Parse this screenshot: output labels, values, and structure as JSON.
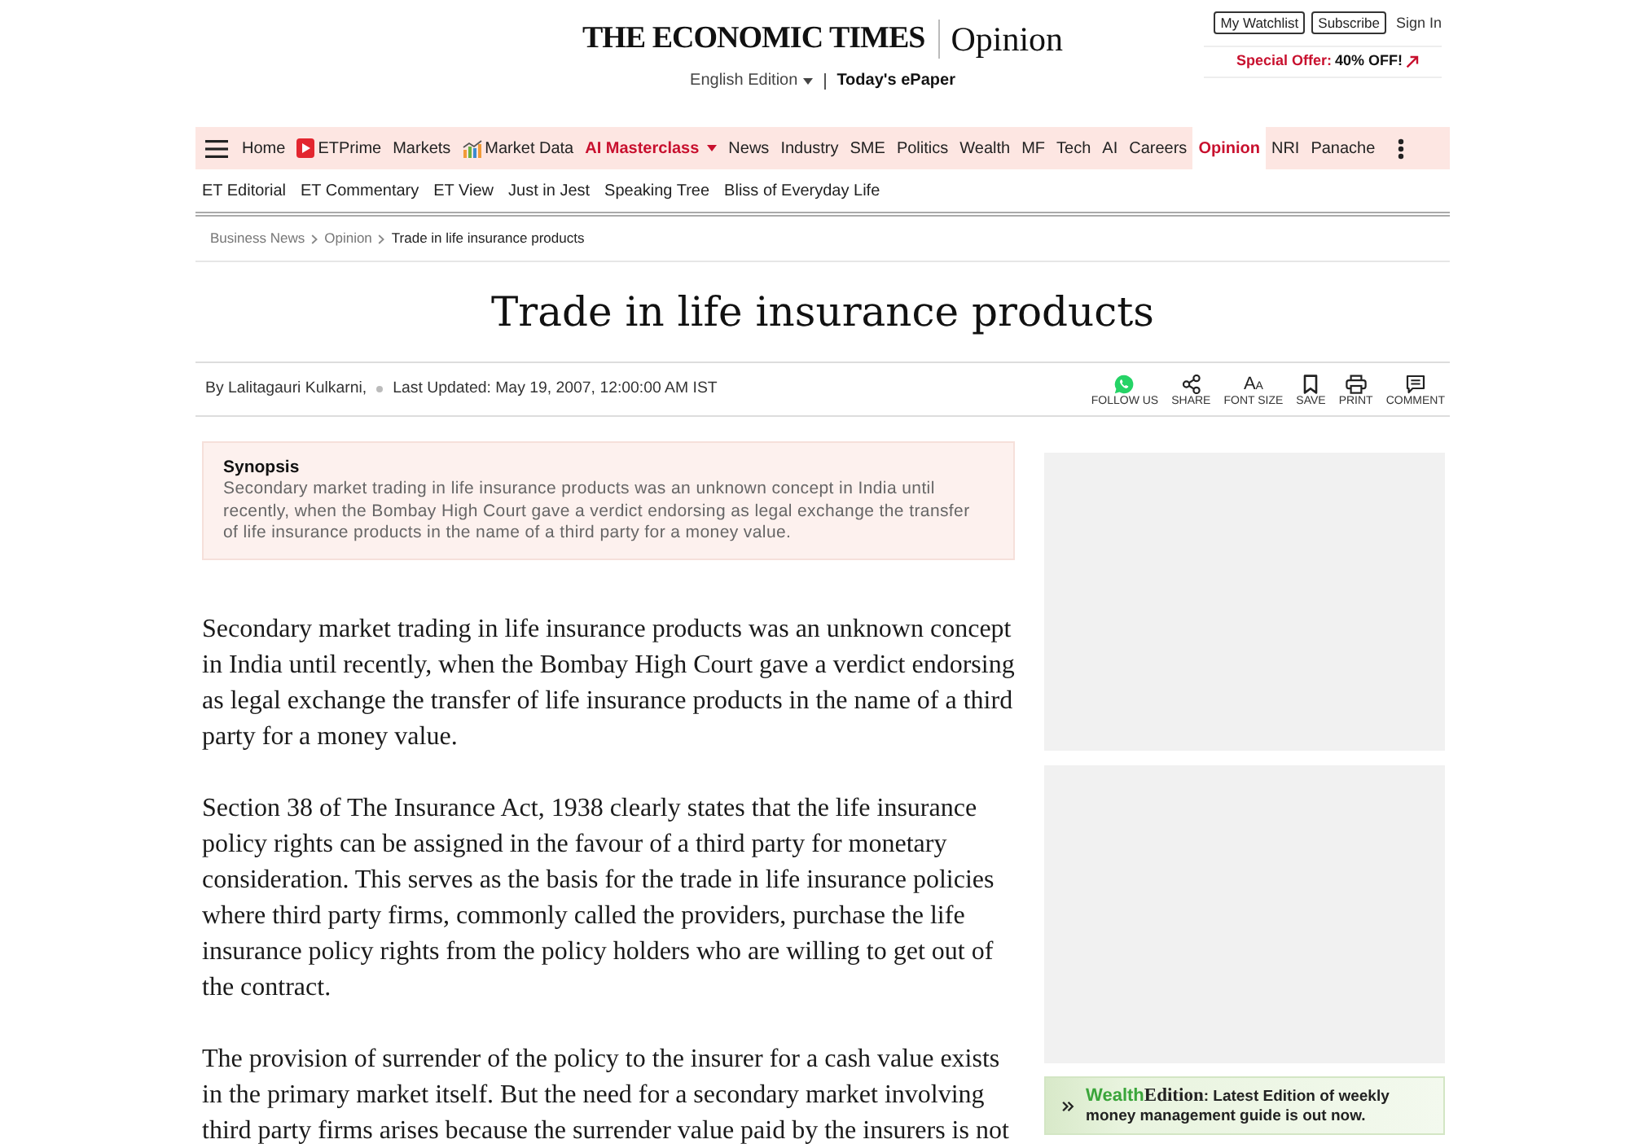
{
  "header": {
    "logo": "THE ECONOMIC TIMES",
    "section": "Opinion",
    "edition": "English Edition",
    "epaper": "Today's ePaper",
    "account_buttons": [
      {
        "label": "My Watchlist",
        "kind": "outline"
      },
      {
        "label": "Subscribe",
        "kind": "outline"
      },
      {
        "label": "Sign In",
        "kind": "link"
      }
    ],
    "offer": {
      "label": "Special Offer:",
      "value": "40% OFF!"
    }
  },
  "nav": [
    {
      "label": "Home",
      "kind": "link",
      "selected": false
    },
    {
      "label": "ETPrime",
      "kind": "prime",
      "selected": false
    },
    {
      "label": "Markets",
      "kind": "link",
      "selected": false
    },
    {
      "label": "Market Data",
      "kind": "chart",
      "selected": false
    },
    {
      "label": "AI Masterclass",
      "kind": "promo",
      "selected": false
    },
    {
      "label": "News",
      "kind": "link",
      "selected": false
    },
    {
      "label": "Industry",
      "kind": "link",
      "selected": false
    },
    {
      "label": "SME",
      "kind": "link",
      "selected": false
    },
    {
      "label": "Politics",
      "kind": "link",
      "selected": false
    },
    {
      "label": "Wealth",
      "kind": "link",
      "selected": false
    },
    {
      "label": "MF",
      "kind": "link",
      "selected": false
    },
    {
      "label": "Tech",
      "kind": "link",
      "selected": false
    },
    {
      "label": "AI",
      "kind": "link",
      "selected": false
    },
    {
      "label": "Careers",
      "kind": "link",
      "selected": false
    },
    {
      "label": "Opinion",
      "kind": "link",
      "selected": true
    },
    {
      "label": "NRI",
      "kind": "link",
      "selected": false
    },
    {
      "label": "Panache",
      "kind": "link",
      "selected": false
    }
  ],
  "subnav": [
    "ET Editorial",
    "ET Commentary",
    "ET View",
    "Just in Jest",
    "Speaking Tree",
    "Bliss of Everyday Life"
  ],
  "breadcrumb": [
    "Business News",
    "Opinion",
    "Trade in life insurance products"
  ],
  "title": "Trade in life insurance products",
  "byline": {
    "author": "By Lalitagauri Kulkarni,",
    "updated": "Last Updated: May 19, 2007, 12:00:00 AM IST"
  },
  "share_tools": [
    {
      "kind": "whatsapp",
      "label": "FOLLOW US"
    },
    {
      "kind": "share",
      "label": "SHARE"
    },
    {
      "kind": "font",
      "label": "FONT SIZE",
      "glyph_large": "A",
      "glyph_small": "A"
    },
    {
      "kind": "save",
      "label": "SAVE"
    },
    {
      "kind": "print",
      "label": "PRINT"
    },
    {
      "kind": "comment",
      "label": "COMMENT"
    }
  ],
  "synopsis": {
    "heading": "Synopsis",
    "text": "Secondary market trading in life insurance products was an unknown concept in India until recently, when the Bombay High Court gave a verdict endorsing as legal exchange the transfer of life insurance products in the name of a third party for a money value."
  },
  "paragraphs": [
    "Secondary market trading in life insurance products was an unknown concept in India until recently, when the Bombay High Court gave a verdict endorsing as legal exchange the transfer of life insurance products in the name of a third party for a money value.",
    "Section 38 of The Insurance Act, 1938 clearly states that the life insurance policy rights can be assigned in the favour of a third party for monetary consideration. This serves as the basis for the trade in life insurance policies where third party firms, commonly called the providers, purchase the life insurance policy rights from the policy holders who are willing to get out of the contract.",
    "The provision of surrender of the policy to the insurer for a cash value exists in the primary market itself. But the need for a secondary market involving third party firms arises because the surrender value paid by the insurers is not"
  ],
  "promo": {
    "brand_first": "Wealth",
    "brand_second": "Edition",
    "text": ": Latest Edition of weekly money management guide is out now."
  }
}
